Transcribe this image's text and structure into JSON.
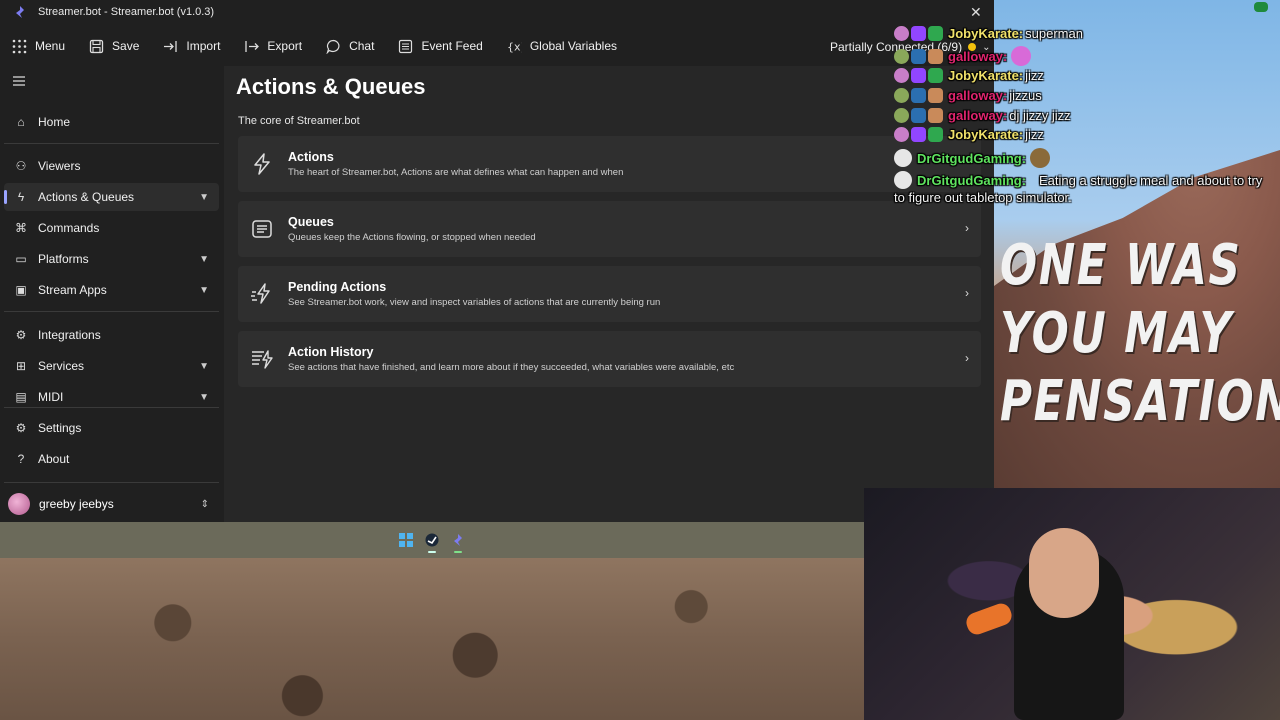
{
  "window": {
    "title": "Streamer.bot - Streamer.bot (v1.0.3)",
    "close_glyph": "✕"
  },
  "toolbar": {
    "menu": "Menu",
    "save": "Save",
    "import": "Import",
    "export": "Export",
    "chat": "Chat",
    "event_feed": "Event Feed",
    "global_variables": "Global Variables",
    "connection_status": "Partially Connected (6/9)",
    "connection_color": "#f4c20d"
  },
  "sidebar": {
    "items": [
      {
        "label": "Home",
        "icon": "home-icon"
      },
      {
        "label": "Viewers",
        "icon": "person-icon"
      },
      {
        "label": "Actions & Queues",
        "icon": "lightning-icon",
        "active": true
      },
      {
        "label": "Commands",
        "icon": "command-icon"
      },
      {
        "label": "Platforms",
        "icon": "platforms-icon"
      },
      {
        "label": "Stream Apps",
        "icon": "stream-apps-icon"
      },
      {
        "label": "Integrations",
        "icon": "plug-icon"
      },
      {
        "label": "Services",
        "icon": "services-icon"
      },
      {
        "label": "MIDI",
        "icon": "midi-icon"
      },
      {
        "label": "Settings",
        "icon": "gear-icon"
      },
      {
        "label": "About",
        "icon": "help-icon"
      }
    ],
    "user": "greeby jeebys"
  },
  "main": {
    "title": "Actions & Queues",
    "subtitle": "The core of Streamer.bot",
    "cards": [
      {
        "title": "Actions",
        "description": "The heart of Streamer.bot, Actions are what defines what can happen and when"
      },
      {
        "title": "Queues",
        "description": "Queues keep the Actions flowing, or stopped when needed"
      },
      {
        "title": "Pending Actions",
        "description": "See Streamer.bot work, view and inspect variables of actions that are currently being run"
      },
      {
        "title": "Action History",
        "description": "See actions that have finished, and learn more about if they succeeded, what variables were available, etc"
      }
    ]
  },
  "chat": {
    "messages": [
      {
        "name": "JobyKarate:",
        "text": "superman",
        "color": "#f0e16a"
      },
      {
        "name": "galloway:",
        "text": "",
        "color": "#e0246e"
      },
      {
        "name": "JobyKarate:",
        "text": "jizz",
        "color": "#f0e16a"
      },
      {
        "name": "galloway:",
        "text": "jizzus",
        "color": "#e0246e"
      },
      {
        "name": "galloway:",
        "text": "dj jizzy jizz",
        "color": "#e0246e"
      },
      {
        "name": "JobyKarate:",
        "text": "jizz",
        "color": "#f0e16a"
      },
      {
        "name": "DrGitgudGaming:",
        "text": "",
        "color": "#5fe35f"
      },
      {
        "name": "DrGitgudGaming:",
        "text": "Eating a struggle meal and about to try to figure out tabletop simulator.",
        "color": "#5fe35f"
      }
    ]
  },
  "scene": {
    "sign_lines": [
      "ONE WAS",
      "YOU MAY",
      "PENSATION"
    ]
  }
}
